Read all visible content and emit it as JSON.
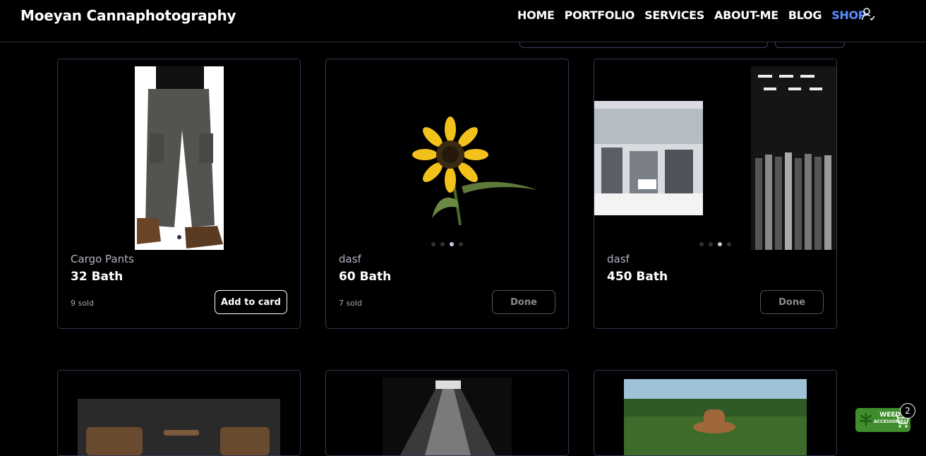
{
  "header": {
    "brand": "Moeyan Cannaphotography",
    "nav": [
      "HOME",
      "PORTFOLIO",
      "SERVICES",
      "ABOUT-ME",
      "BLOG",
      "SHOP"
    ],
    "active_nav": "SHOP"
  },
  "products": [
    {
      "name": "Cargo Pants",
      "price": "32 Bath",
      "sold": "9 sold",
      "button": "Add to card"
    },
    {
      "name": "dasf",
      "price": "60 Bath",
      "sold": "7 sold",
      "button": "Done"
    },
    {
      "name": "dasf",
      "price": "450 Bath",
      "sold": "",
      "button": "Done"
    }
  ],
  "cart_badge": {
    "label_line1": "WEED",
    "label_line2": "ACCESSORIES",
    "count": "2"
  },
  "colors": {
    "accent": "#5b8dff",
    "badge_green": "#3f8d2d",
    "card_border": "#2f3850"
  }
}
